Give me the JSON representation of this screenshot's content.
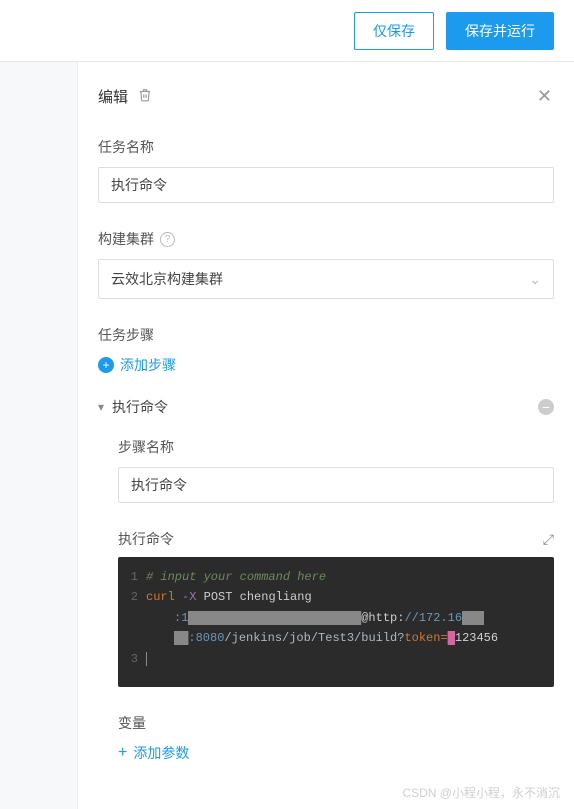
{
  "topbar": {
    "save_only": "仅保存",
    "save_run": "保存并运行"
  },
  "panel": {
    "title": "编辑"
  },
  "fields": {
    "task_name_label": "任务名称",
    "task_name_value": "执行命令",
    "cluster_label": "构建集群",
    "cluster_value": "云效北京构建集群",
    "steps_label": "任务步骤",
    "add_step": "添加步骤"
  },
  "step": {
    "title": "执行命令",
    "step_name_label": "步骤名称",
    "step_name_value": "执行命令",
    "cmd_label": "执行命令",
    "code_line1": "# input your command here",
    "code_curl": "curl",
    "code_flag": "-X",
    "code_method": "POST",
    "code_user": "chengliang",
    "code_c1": ":1",
    "code_at": "@http:",
    "code_host": "//172.16",
    "code_port": ":8080",
    "code_path": "/jenkins/job/Test3/build?",
    "code_token": "token=",
    "code_tokval": "123456"
  },
  "vars": {
    "label": "变量",
    "add_param": "添加参数"
  },
  "watermark": "CSDN @小程小程，永不消沉"
}
